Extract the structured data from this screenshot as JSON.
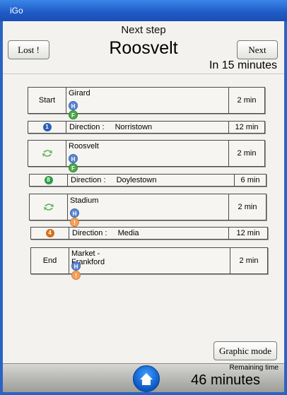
{
  "window": {
    "title": "iGo"
  },
  "header": {
    "next_step_label": "Next step",
    "station": "Roosvelt",
    "eta": "In 15 minutes",
    "lost_button": "Lost !",
    "next_button": "Next"
  },
  "route": {
    "start": {
      "lead": "Start",
      "station": "Girard",
      "lines": [
        "H",
        "F"
      ],
      "time": "2 min"
    },
    "leg1": {
      "line": "1",
      "line_color": "#2a5fb8",
      "direction_label": "Direction :",
      "direction": "Norristown",
      "time": "12 min"
    },
    "transfer1": {
      "station": "Roosvelt",
      "lines": [
        "H",
        "F"
      ],
      "time": "2 min"
    },
    "leg2": {
      "line": "8",
      "line_color": "#2f9e44",
      "direction_label": "Direction :",
      "direction": "Doylestown",
      "time": "6 min"
    },
    "transfer2": {
      "station": "Stadium",
      "lines": [
        "H",
        "!"
      ],
      "time": "2 min"
    },
    "leg3": {
      "line": "4",
      "line_color": "#d86d18",
      "direction_label": "Direction :",
      "direction": "Media",
      "time": "12 min"
    },
    "end": {
      "lead": "End",
      "station": "Market - Frankford",
      "lines": [
        "H",
        "!"
      ],
      "time": "2 min"
    }
  },
  "graphic_mode_button": "Graphic mode",
  "footer": {
    "remaining_label": "Remaining time",
    "remaining_value": "46 minutes"
  },
  "icons": {
    "transfer": "transfer-arrows-icon",
    "home": "home-icon",
    "handicap": "accessible-icon",
    "warning": "warning-icon"
  }
}
